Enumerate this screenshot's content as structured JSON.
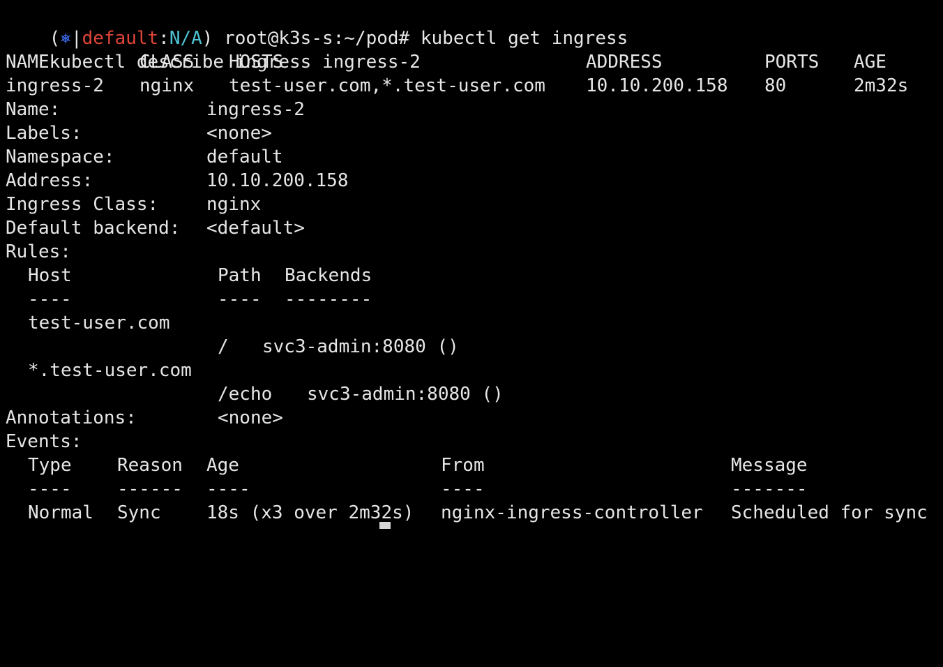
{
  "colors": {
    "background": "#000000",
    "text": "#e6e6e6",
    "kube_icon": "#3b6df0",
    "context": "#e0453a",
    "namespace": "#4fc3d6"
  },
  "prompt": {
    "open_paren": "(",
    "icon": "⎈",
    "sep": "|",
    "context": "default",
    "colon": ":",
    "namespace": "N/A",
    "close": ")",
    "user_path": " root@k3s-s:~/pod# ",
    "command1": "kubectl get ingress",
    "command2": "kubectl describe ingress ingress-2"
  },
  "get_table": {
    "headers": [
      "NAME",
      "CLASS",
      "HOSTS",
      "ADDRESS",
      "PORTS",
      "AGE"
    ],
    "rows": [
      [
        "ingress-2",
        "nginx",
        "test-user.com,*.test-user.com",
        "10.10.200.158",
        "80",
        "2m32s"
      ]
    ]
  },
  "describe": {
    "fields": [
      {
        "key": "Name:",
        "value": "ingress-2"
      },
      {
        "key": "Labels:",
        "value": "<none>"
      },
      {
        "key": "Namespace:",
        "value": "default"
      },
      {
        "key": "Address:",
        "value": "10.10.200.158"
      },
      {
        "key": "Ingress Class:",
        "value": "nginx"
      },
      {
        "key": "Default backend:",
        "value": "<default>"
      }
    ],
    "rules_label": "Rules:",
    "rules_headers": [
      "Host",
      "Path",
      "Backends"
    ],
    "rules_underlines": [
      "----",
      "----",
      "--------"
    ],
    "rules": [
      {
        "host": "test-user.com",
        "path": "/",
        "backend": "svc3-admin:8080 ()"
      },
      {
        "host": "*.test-user.com",
        "path": "/echo",
        "backend": "svc3-admin:8080 ()"
      }
    ],
    "annotations_label": "Annotations:",
    "annotations_value": "<none>",
    "events_label": "Events:",
    "events_headers": [
      "Type",
      "Reason",
      "Age",
      "From",
      "Message"
    ],
    "events_underlines": [
      "----",
      "------",
      "----",
      "----",
      "-------"
    ],
    "events": [
      {
        "type": "Normal",
        "reason": "Sync",
        "age": "18s (x3 over 2m32s)",
        "from": "nginx-ingress-controller",
        "message": "Scheduled for sync"
      }
    ]
  }
}
